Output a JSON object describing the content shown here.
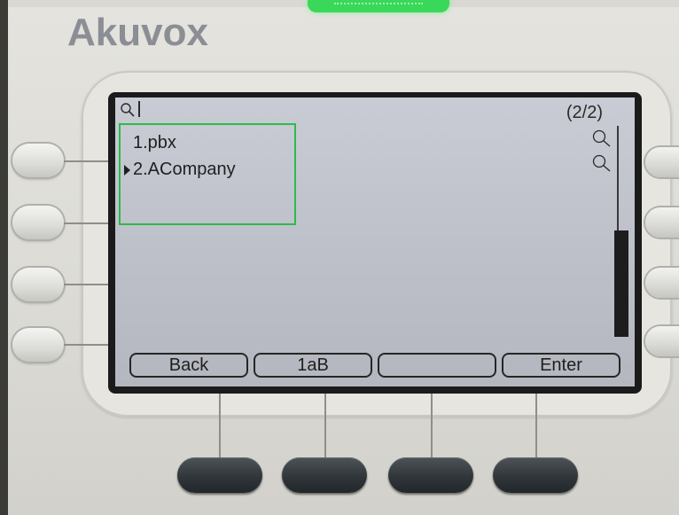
{
  "device": {
    "brand": "Akuvox"
  },
  "screen": {
    "page_indicator": "(2/2)",
    "entries": [
      {
        "label": "1.pbx",
        "selected": false
      },
      {
        "label": "2.ACompany",
        "selected": true
      }
    ],
    "highlight_color": "#2dbb47"
  },
  "softkeys": [
    {
      "label": "Back"
    },
    {
      "label": "1aB"
    },
    {
      "label": ""
    },
    {
      "label": "Enter"
    }
  ],
  "icons": {
    "top_left": "magnifier-icon",
    "entry_1": "magnifier-icon",
    "entry_2": "magnifier-icon"
  },
  "colors": {
    "indicator_led": "#39d85a",
    "screen_background": "#c4c7cf"
  }
}
